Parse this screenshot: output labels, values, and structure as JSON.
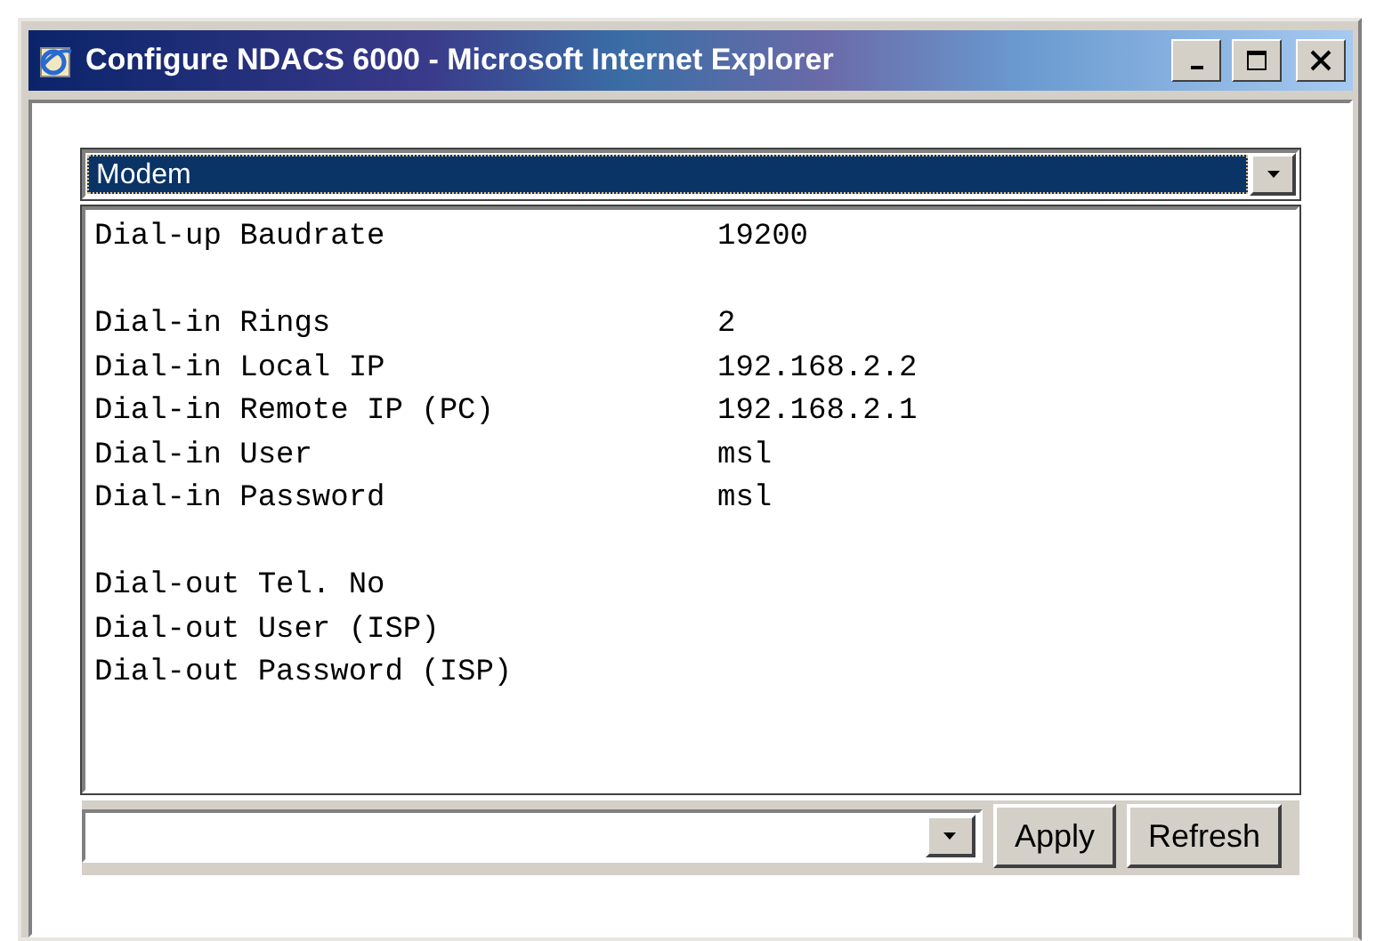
{
  "window": {
    "title": "Configure NDACS 6000 - Microsoft Internet Explorer"
  },
  "section_select": {
    "value": "Modem"
  },
  "settings": [
    [
      {
        "label": "Dial-up Baudrate",
        "value": "19200"
      }
    ],
    [
      {
        "label": "Dial-in Rings",
        "value": "2"
      },
      {
        "label": "Dial-in Local IP",
        "value": "192.168.2.2"
      },
      {
        "label": "Dial-in Remote IP (PC)",
        "value": "192.168.2.1"
      },
      {
        "label": "Dial-in User",
        "value": "msl"
      },
      {
        "label": "Dial-in Password",
        "value": "msl"
      }
    ],
    [
      {
        "label": "Dial-out Tel. No"
      },
      {
        "label": "Dial-out User (ISP)"
      },
      {
        "label": "Dial-out Password (ISP)"
      }
    ]
  ],
  "buttons": [
    "Apply",
    "Refresh"
  ]
}
